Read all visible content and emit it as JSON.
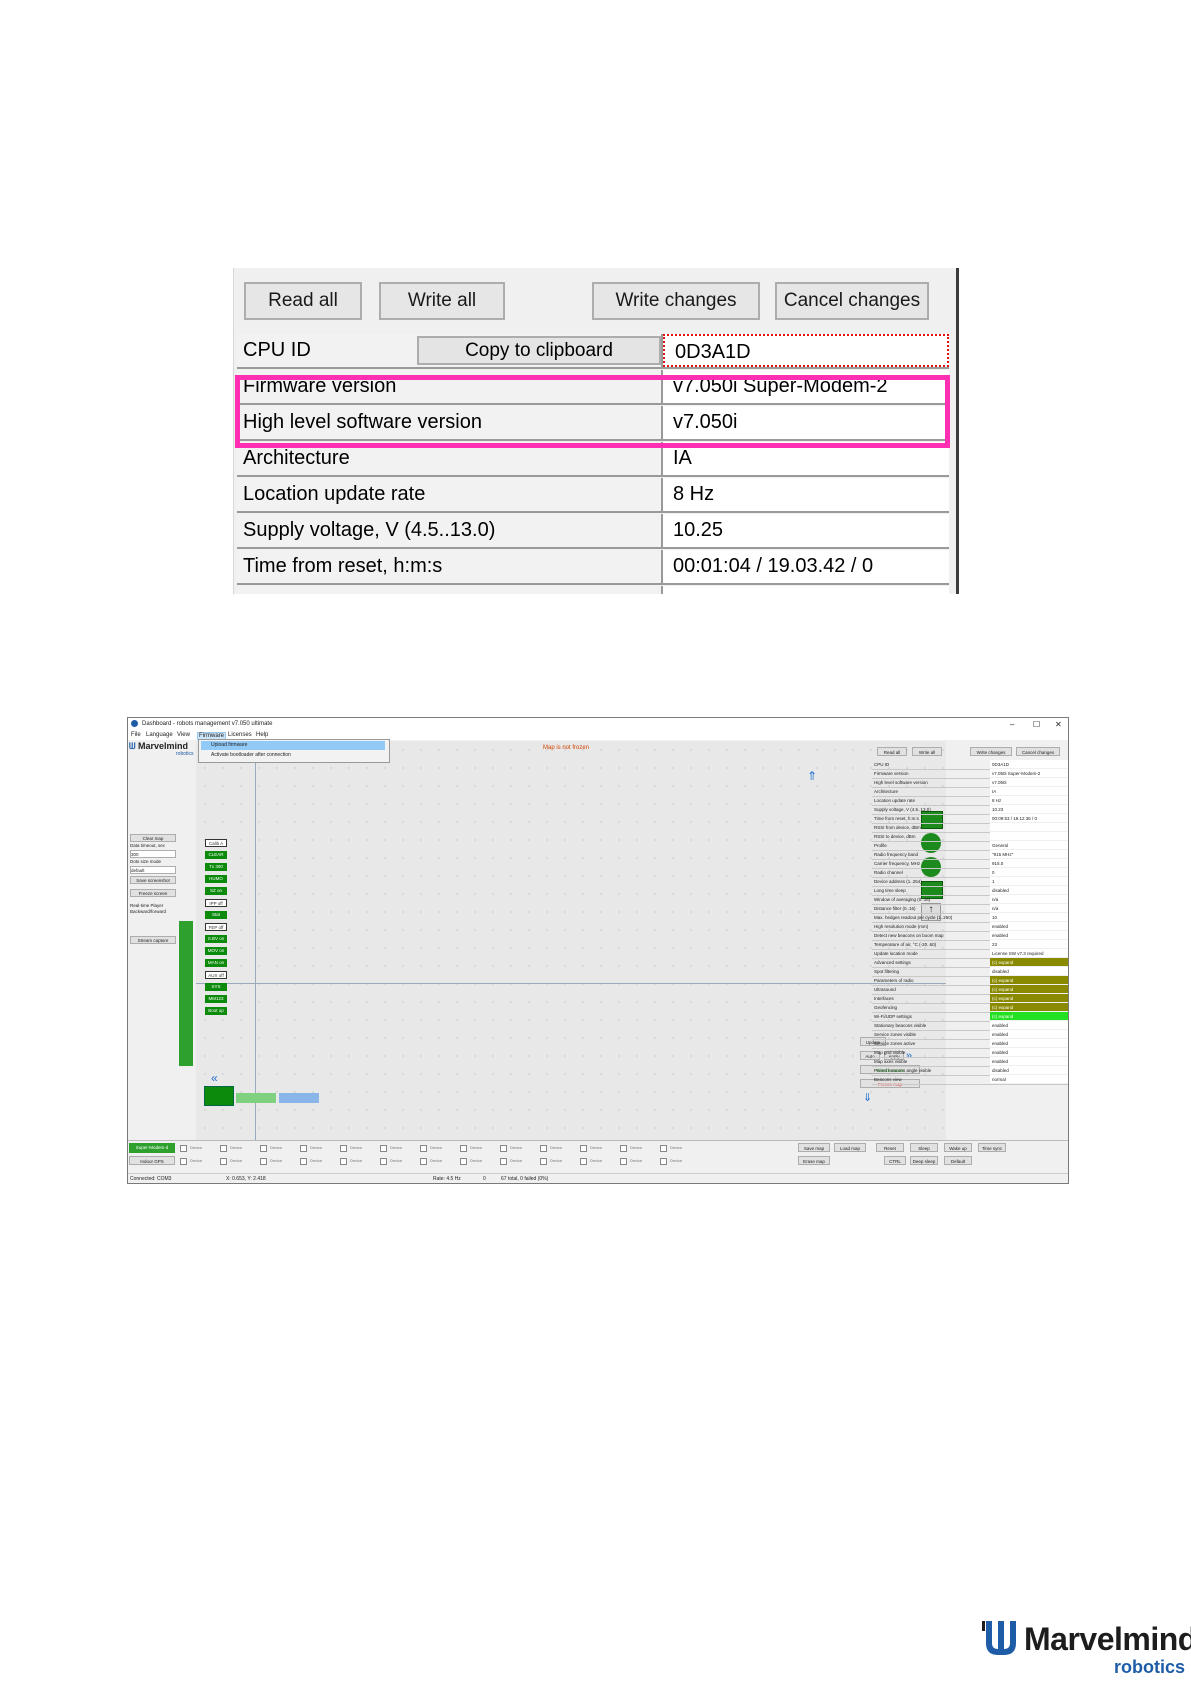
{
  "zoom_panel": {
    "buttons": {
      "read_all": "Read all",
      "write_all": "Write all",
      "write_changes": "Write changes",
      "cancel_changes": "Cancel changes"
    },
    "copy_to_clipboard": "Copy to clipboard",
    "rows": [
      {
        "key": "CPU ID",
        "value": "0D3A1D"
      },
      {
        "key": "Firmware version",
        "value": "v7.050i Super-Modem-2"
      },
      {
        "key": "High level software version",
        "value": "v7.050i"
      },
      {
        "key": "Architecture",
        "value": "IA"
      },
      {
        "key": "Location update rate",
        "value": "8 Hz"
      },
      {
        "key": "Supply voltage, V (4.5..13.0)",
        "value": "10.25"
      },
      {
        "key": "Time from reset, h:m:s",
        "value": "00:01:04 / 19.03.42 / 0"
      }
    ],
    "highlight_color": "#ff2fb4"
  },
  "dashboard": {
    "title": "Dashboard - robots management  v7.050  ultimate",
    "window_controls": [
      "–",
      "☐",
      "✕"
    ],
    "menu": [
      "File",
      "Language",
      "View",
      "Firmware",
      "Licenses",
      "Help"
    ],
    "dropdown": [
      "Upload firmware",
      "Activate bootloader after connection"
    ],
    "map_note": "Map is not frozen",
    "logo": "Marvelmind",
    "logo_sub": "robotics",
    "left_panel": {
      "clear_map": "Clear map",
      "data_timeout_label": "Data timeout, sec",
      "data_timeout_value": "300",
      "dots_size_label": "Dots size mode",
      "dots_size_value": "default",
      "save_screenshot": "Save screenshot",
      "freeze_screen": "Freeze screen",
      "realtime_player": "Real-time Player",
      "backward_forward": "Backward/forward",
      "stream_capture": "Stream capture"
    },
    "tags": [
      "Calib A",
      "CLEAR",
      "Tx 300",
      "HUMO",
      "SZ on",
      "IPP off",
      "Stat",
      "FEP off",
      "S.BV on",
      "MOV on",
      "MAN on",
      "AUX off",
      "SYS",
      "MM123",
      "Boot up"
    ],
    "right_buttons": [
      "Update",
      "Auto",
      "Apply",
      "Freeze zones",
      "Freeze map"
    ],
    "prop_buttons": [
      "Read all",
      "Write all",
      "Write changes",
      "Cancel changes"
    ],
    "props": [
      {
        "k": "CPU ID",
        "v": "0D3A1D"
      },
      {
        "k": "Firmware version",
        "v": "v7.050i Super-Modem-2"
      },
      {
        "k": "High level software version",
        "v": "v7.050i"
      },
      {
        "k": "Architecture",
        "v": "IA"
      },
      {
        "k": "Location update rate",
        "v": "8 Hz"
      },
      {
        "k": "Supply voltage, V (4.5..13.0)",
        "v": "10.23"
      },
      {
        "k": "Time from reset, h:m:s",
        "v": "00:09:53 / 19.12.36 / 0"
      },
      {
        "k": "RSSI from device, dBm",
        "v": ""
      },
      {
        "k": "RSSI to device, dBm",
        "v": ""
      },
      {
        "k": "Profile",
        "v": "General"
      },
      {
        "k": "Radio frequency band",
        "v": "\"915 MHz\""
      },
      {
        "k": "Carrier frequency, MHz",
        "v": "915.0"
      },
      {
        "k": "Radio channel",
        "v": "0"
      },
      {
        "k": "Device address (1..254)",
        "v": "1"
      },
      {
        "k": "Long time sleep",
        "v": "disabled"
      },
      {
        "k": "Window of averaging (0..16)",
        "v": "n/a"
      },
      {
        "k": "Distance filter (0..16)",
        "v": "n/a"
      },
      {
        "k": "Max. hedges readout per cycle (1..250)",
        "v": "10"
      },
      {
        "k": "High resolution mode (mm)",
        "v": "enabled"
      },
      {
        "k": "Detect new beacons on boom map",
        "v": "enabled"
      },
      {
        "k": "Temperature of air, °C (-20..60)",
        "v": "23"
      },
      {
        "k": "Update location mode",
        "v": "License SW v7.3 required"
      },
      {
        "k": "Advanced settings",
        "v": "(c) expand",
        "style": "olive"
      },
      {
        "k": "Spot filtering",
        "v": "disabled"
      },
      {
        "k": "Parameters of radio",
        "v": "(c) expand",
        "style": "olive"
      },
      {
        "k": "Ultrasound",
        "v": "(c) expand",
        "style": "olive"
      },
      {
        "k": "Interfaces",
        "v": "(c) expand",
        "style": "olive"
      },
      {
        "k": "Geofencing",
        "v": "(c) expand",
        "style": "olive"
      },
      {
        "k": "Wi-Fi/UDP settings",
        "v": "(c) expand",
        "style": "lime"
      },
      {
        "k": "Stationary beacons visible",
        "v": "enabled"
      },
      {
        "k": "Service zones visible",
        "v": "enabled"
      },
      {
        "k": "Service zones active",
        "v": "enabled"
      },
      {
        "k": "Map grid visible",
        "v": "enabled"
      },
      {
        "k": "Map axes visible",
        "v": "enabled"
      },
      {
        "k": "Paired beacons angle visible",
        "v": "disabled"
      },
      {
        "k": "Beacons view",
        "v": "normal"
      }
    ],
    "bottom": {
      "modem_label": "Super-Modem-d",
      "gps_label": "Indoor GPS",
      "save_map": "Save map",
      "load_map": "Load map",
      "erase_map": "Erase map",
      "reset": "Reset",
      "sleep": "Sleep",
      "wake_up": "Wake up",
      "time_sync": "Time sync",
      "ctrl": "CTRL",
      "deep_sleep": "Deep sleep",
      "default": "Default",
      "device": "Device"
    },
    "status": {
      "connected": "Connected: COM3",
      "coords": "X: 0.653, Y: 2.418",
      "rate": "Rate: 4.5 Hz",
      "zero": "0",
      "total": "67 total, 0 failed (0%)"
    }
  },
  "footer_logo": {
    "word": "Marvelmind",
    "sub": "robotics",
    "color": "#1f5ca8"
  }
}
